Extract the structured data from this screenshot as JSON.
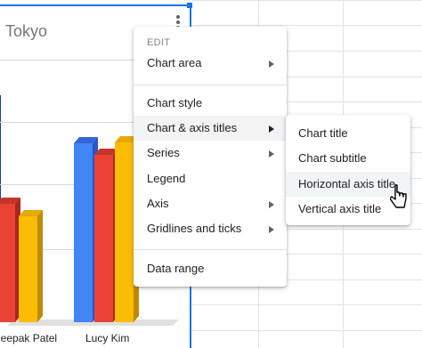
{
  "chart": {
    "title": "Tokyo",
    "category_labels": [
      "Deepak Patel",
      "Lucy Kim"
    ],
    "series_colors": [
      "#4285f4",
      "#ea4335",
      "#fbbc04"
    ]
  },
  "menu": {
    "header": "EDIT",
    "items": [
      {
        "label": "Chart area",
        "submenu": true
      },
      {
        "label": "Chart style",
        "submenu": false
      },
      {
        "label": "Chart & axis titles",
        "submenu": true
      },
      {
        "label": "Series",
        "submenu": true
      },
      {
        "label": "Legend",
        "submenu": false
      },
      {
        "label": "Axis",
        "submenu": true
      },
      {
        "label": "Gridlines and ticks",
        "submenu": true
      },
      {
        "label": "Data range",
        "submenu": false
      }
    ]
  },
  "submenu": {
    "items": [
      {
        "label": "Chart title"
      },
      {
        "label": "Chart subtitle"
      },
      {
        "label": "Horizontal axis title"
      },
      {
        "label": "Vertical axis title"
      }
    ]
  }
}
